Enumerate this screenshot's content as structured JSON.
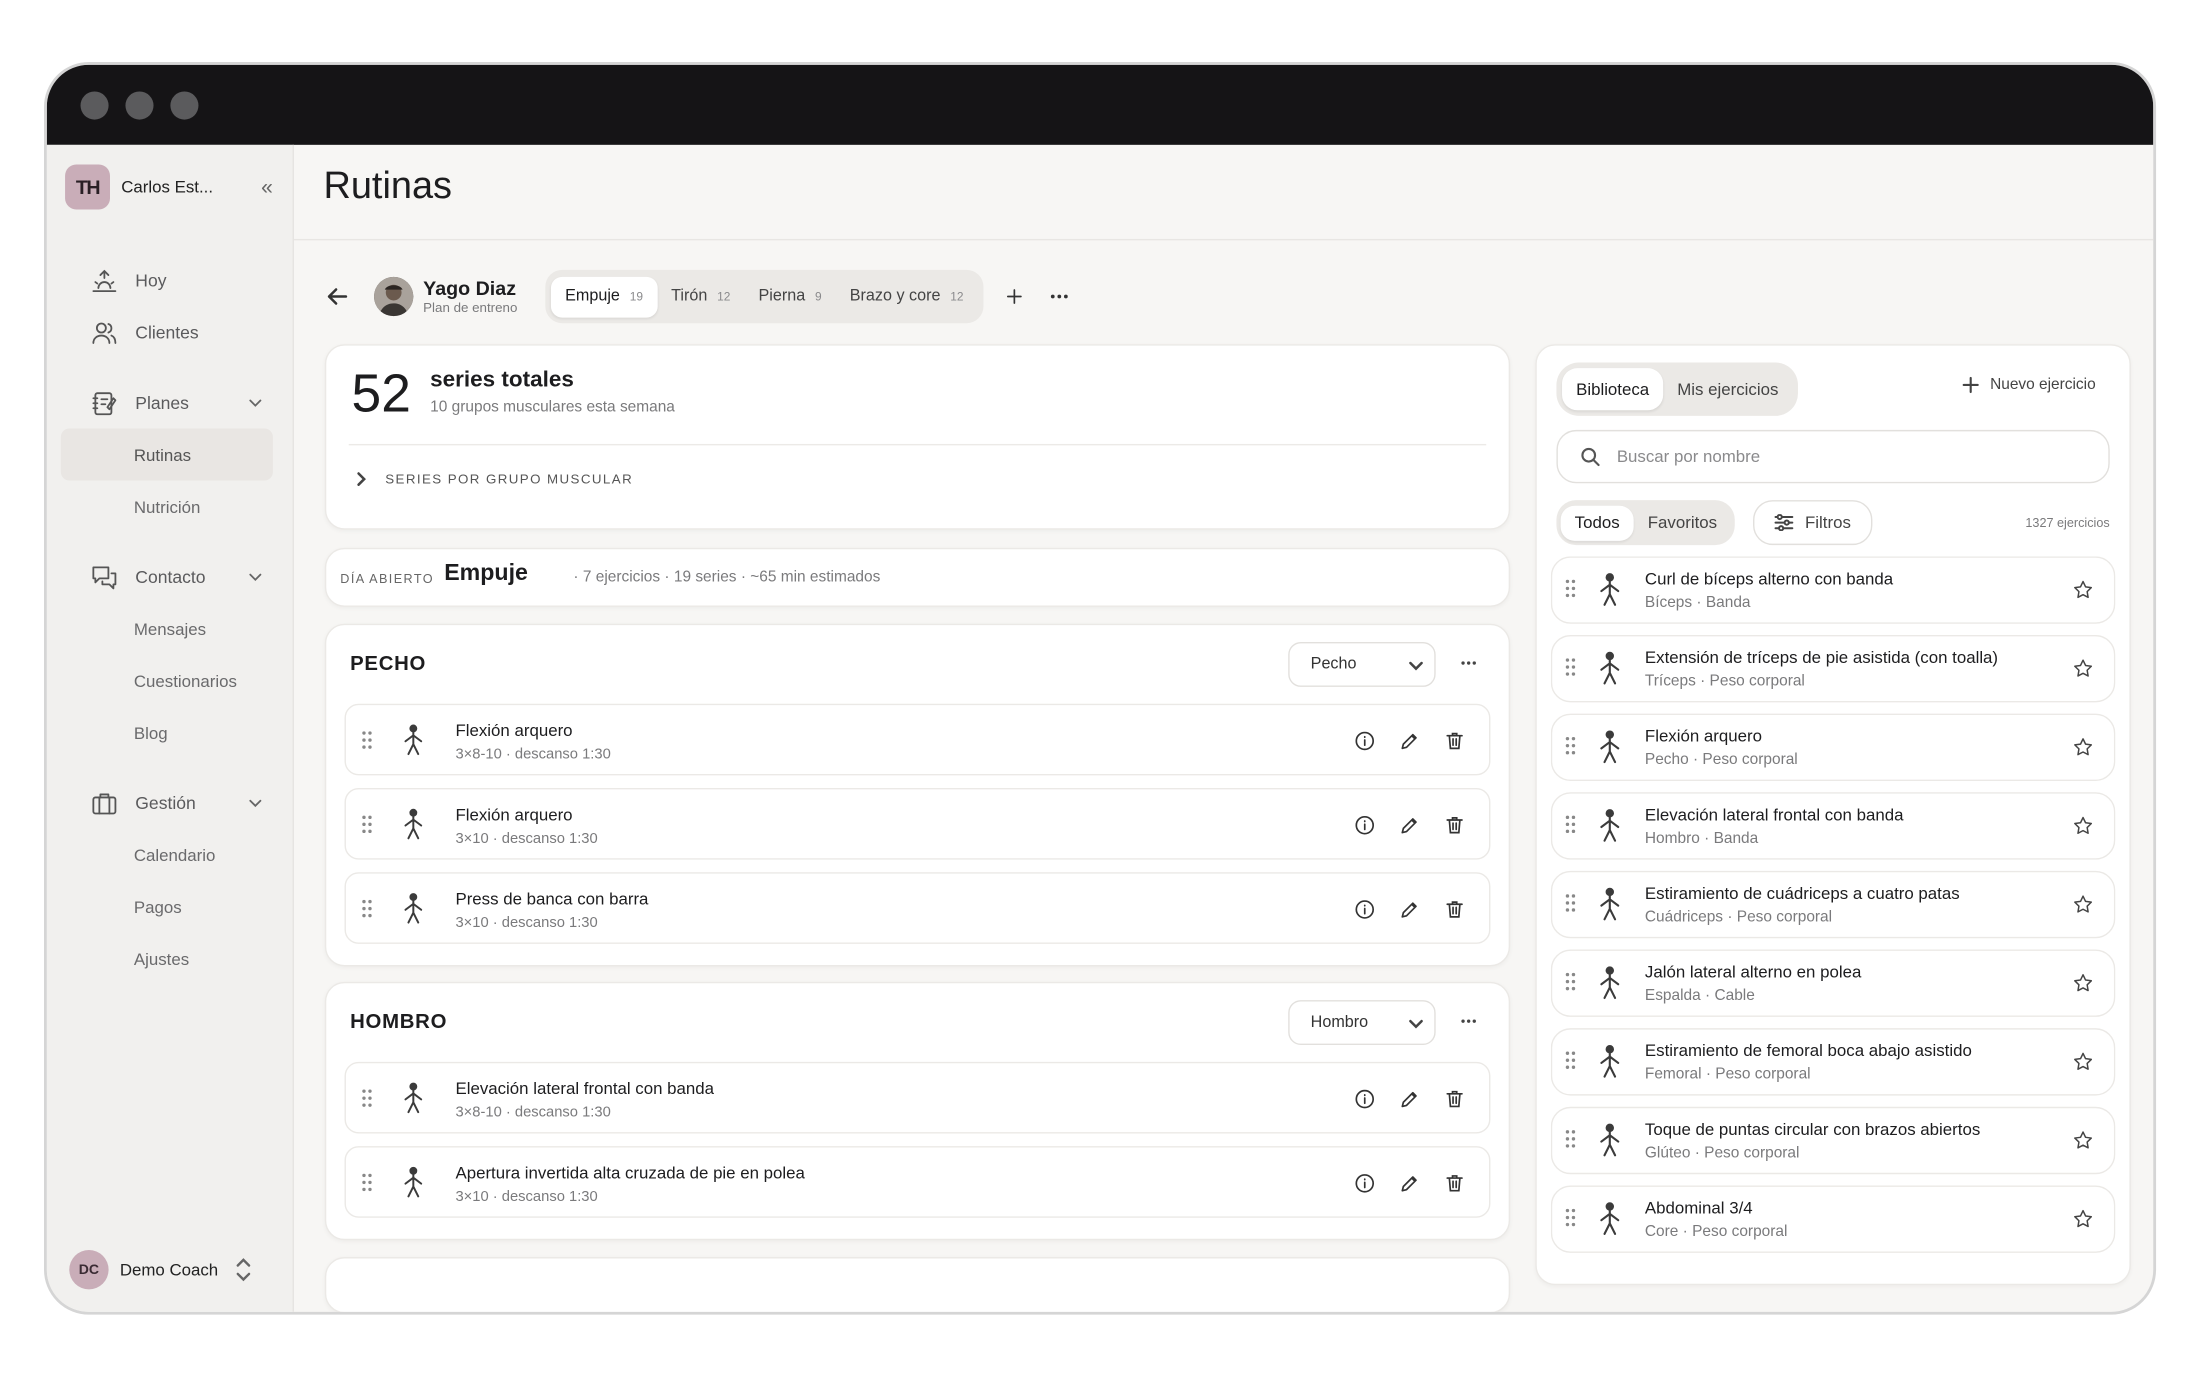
{
  "sidebar": {
    "brand": {
      "logo": "TH",
      "name": "Carlos Est..."
    },
    "nav": [
      {
        "label": "Hoy",
        "icon": "sunrise-icon"
      },
      {
        "label": "Clientes",
        "icon": "users-icon"
      },
      {
        "label": "Planes",
        "icon": "notebook-icon",
        "children": [
          "Rutinas",
          "Nutrición"
        ]
      },
      {
        "label": "Contacto",
        "icon": "chat-icon",
        "children": [
          "Mensajes",
          "Cuestionarios",
          "Blog"
        ]
      },
      {
        "label": "Gestión",
        "icon": "briefcase-icon",
        "children": [
          "Calendario",
          "Pagos",
          "Ajustes"
        ]
      }
    ],
    "active": "Rutinas",
    "user": {
      "initials": "DC",
      "name": "Demo Coach"
    }
  },
  "page": {
    "title": "Rutinas"
  },
  "client": {
    "name": "Yago Diaz",
    "subtitle": "Plan de entreno"
  },
  "day_tabs": [
    {
      "label": "Empuje",
      "count": "19",
      "active": true
    },
    {
      "label": "Tirón",
      "count": "12"
    },
    {
      "label": "Pierna",
      "count": "9"
    },
    {
      "label": "Brazo y core",
      "count": "12"
    }
  ],
  "stats": {
    "total": "52",
    "title": "series totales",
    "subtitle": "10 grupos musculares esta semana",
    "link": "SERIES POR GRUPO MUSCULAR"
  },
  "day": {
    "label": "DÍA ABIERTO",
    "name": "Empuje",
    "meta": "· 7 ejercicios · 19 series  · ~65 min estimados"
  },
  "groups": [
    {
      "title": "PECHO",
      "select": "Pecho",
      "exercises": [
        {
          "name": "Flexión arquero",
          "detail": "3×8-10 · descanso 1:30"
        },
        {
          "name": "Flexión arquero",
          "detail": "3×10 · descanso 1:30"
        },
        {
          "name": "Press de banca con barra",
          "detail": "3×10 · descanso 1:30"
        }
      ]
    },
    {
      "title": "HOMBRO",
      "select": "Hombro",
      "exercises": [
        {
          "name": "Elevación lateral frontal con banda",
          "detail": "3×8-10 · descanso 1:30"
        },
        {
          "name": "Apertura invertida alta cruzada de pie en polea",
          "detail": "3×10 · descanso 1:30"
        }
      ]
    }
  ],
  "library": {
    "tabs": [
      "Biblioteca",
      "Mis ejercicios"
    ],
    "active_tab": "Biblioteca",
    "new_label": "Nuevo ejercicio",
    "search_placeholder": "Buscar por nombre",
    "filters": [
      "Todos",
      "Favoritos"
    ],
    "active_filter": "Todos",
    "filters_button": "Filtros",
    "count": "1327 ejercicios",
    "items": [
      {
        "name": "Curl de bíceps alterno con banda",
        "detail": "Bíceps · Banda"
      },
      {
        "name": "Extensión de tríceps de pie asistida (con toalla)",
        "detail": "Tríceps · Peso corporal"
      },
      {
        "name": "Flexión arquero",
        "detail": "Pecho · Peso corporal"
      },
      {
        "name": "Elevación lateral frontal con banda",
        "detail": "Hombro · Banda"
      },
      {
        "name": "Estiramiento de cuádriceps a cuatro patas",
        "detail": "Cuádriceps · Peso corporal"
      },
      {
        "name": "Jalón lateral alterno en polea",
        "detail": "Espalda · Cable"
      },
      {
        "name": "Estiramiento de femoral boca abajo asistido",
        "detail": "Femoral · Peso corporal"
      },
      {
        "name": "Toque de puntas circular con brazos abiertos",
        "detail": "Glúteo · Peso corporal"
      },
      {
        "name": "Abdominal 3/4",
        "detail": "Core · Peso corporal"
      }
    ]
  }
}
